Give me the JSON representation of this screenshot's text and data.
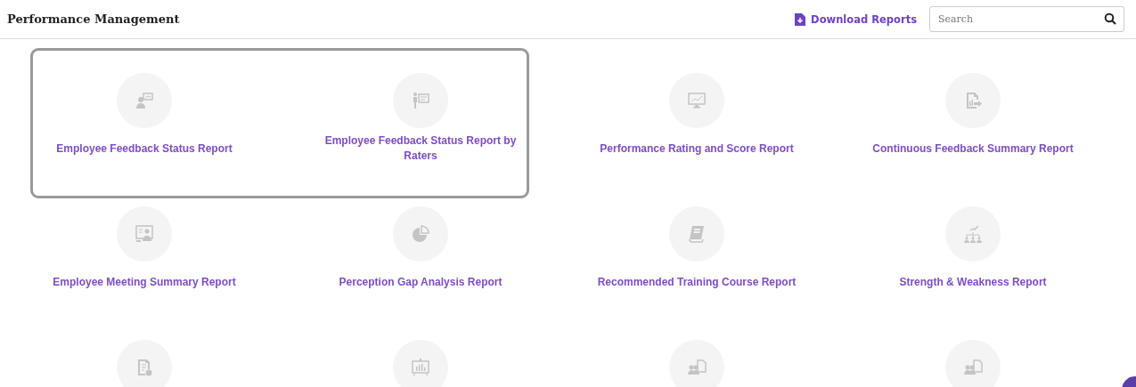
{
  "header": {
    "title": "Performance Management",
    "download_link": "Download Reports",
    "search": {
      "placeholder": "Search"
    }
  },
  "tiles": [
    {
      "label": "Employee Feedback Status Report",
      "selected": true
    },
    {
      "label": "Employee Feedback Status Report by Raters",
      "selected": true
    },
    {
      "label": "Performance Rating and Score Report",
      "selected": false
    },
    {
      "label": "Continuous Feedback Summary Report",
      "selected": false
    },
    {
      "label": "Employee Meeting Summary Report",
      "selected": false
    },
    {
      "label": "Perception Gap Analysis Report",
      "selected": false
    },
    {
      "label": "Recommended Training Course Report",
      "selected": false
    },
    {
      "label": "Strength & Weakness Report",
      "selected": false
    },
    {
      "selected": false
    },
    {
      "selected": false
    },
    {
      "selected": false
    },
    {
      "selected": false
    }
  ]
}
